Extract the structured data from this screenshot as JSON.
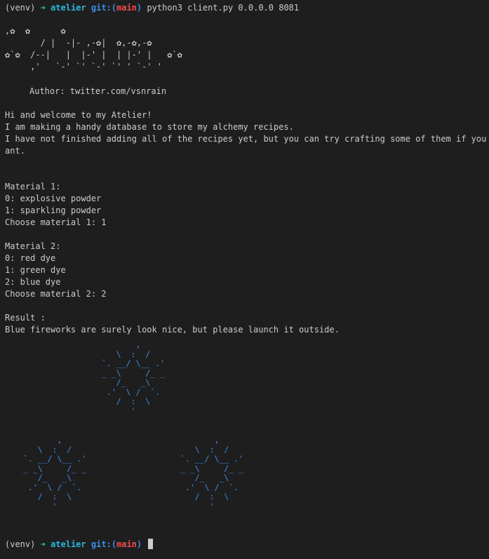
{
  "prompt": {
    "venv": "(venv)",
    "arrow": "➜",
    "dir": "atelier",
    "git_label": "git:(",
    "branch": "main",
    "git_close": ")",
    "command": "python3 client.py 0.0.0.0 8081"
  },
  "banner": {
    "logo_art": ",✿  ✿      ✿\n       / |  -|- ,-✿|  ✿,-✿,-✿\n✿`✿  /--|   |  |-' |  | |-' |   ✿`✿\n     ,'   `-' `' `-' `' ' `-' '",
    "author": "Author: twitter.com/vsnrain"
  },
  "intro": [
    "Hi and welcome to my Atelier!",
    "I am making a handy database to store my alchemy recipes.",
    "I have not finished adding all of the recipes yet, but you can try crafting some of them if you w",
    "ant."
  ],
  "material1": {
    "heading": "Material 1:",
    "options": [
      "0: explosive powder",
      "1: sparkling powder"
    ],
    "choose": "Choose material 1: 1"
  },
  "material2": {
    "heading": "Material 2:",
    "options": [
      "0: red dye",
      "1: green dye",
      "2: blue dye"
    ],
    "choose": "Choose material 2: 2"
  },
  "result": {
    "heading": "Result :",
    "text": "Blue fireworks are surely look nice, but please launch it outside."
  },
  "fireworks": {
    "color": "#3b8eea",
    "art": "       ,\n   \\  :  /\n`. __/ \\__ .'\n_ _\\     /_ _\n   /_   _\\\n .'  \\ /  `.\n   /  :  \\\n      '"
  },
  "colors": {
    "background": "#1e1e1e",
    "text": "#cccccc",
    "arrow": "#23d18b",
    "dir": "#29b8db",
    "git": "#3b8eea",
    "branch": "#f14c4c"
  }
}
